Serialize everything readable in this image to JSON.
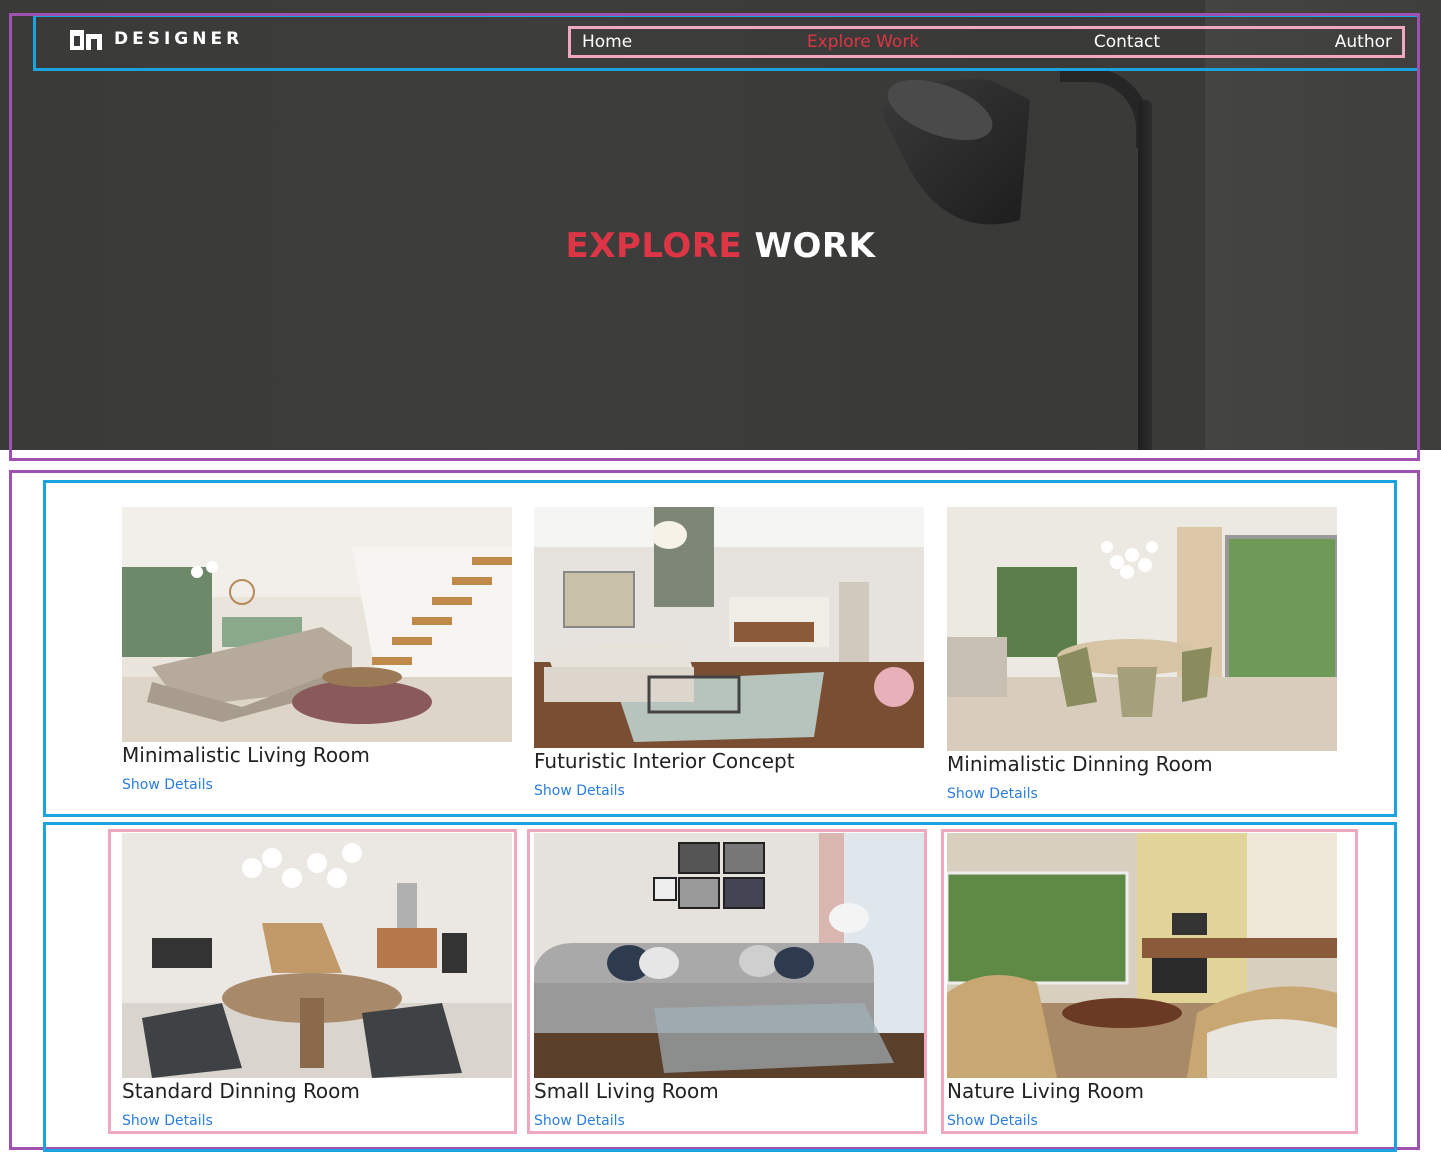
{
  "brand": {
    "name": "DESIGNER",
    "icon": "dm-logo-icon"
  },
  "nav": {
    "items": [
      {
        "label": "Home",
        "active": false
      },
      {
        "label": "Explore Work",
        "active": true
      },
      {
        "label": "Contact",
        "active": false
      },
      {
        "label": "Author",
        "active": false
      }
    ]
  },
  "hero": {
    "title_accent": "EXPLORE",
    "title_rest": "WORK"
  },
  "gallery": {
    "cards": [
      {
        "title": "Minimalistic Living Room",
        "link": "Show Details"
      },
      {
        "title": "Futuristic Interior Concept",
        "link": "Show Details"
      },
      {
        "title": "Minimalistic Dinning Room",
        "link": "Show Details"
      },
      {
        "title": "Standard Dinning Room",
        "link": "Show Details"
      },
      {
        "title": "Small Living Room",
        "link": "Show Details"
      },
      {
        "title": "Nature Living Room",
        "link": "Show Details"
      }
    ]
  },
  "colors": {
    "accent": "#dc3545",
    "link": "#2a7de1",
    "hero_bg": "#3b3b39"
  }
}
